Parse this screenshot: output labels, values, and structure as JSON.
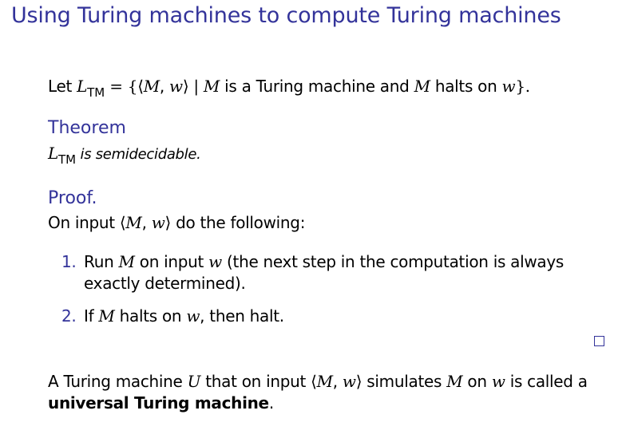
{
  "slide": {
    "title": "Using Turing machines to compute Turing machines"
  },
  "definition": {
    "prefix": "Let ",
    "set_name": "L",
    "subscript": "TM",
    "equals_part": " = {⟨",
    "m1": "M",
    "comma1": ", ",
    "w1": "w",
    "bar_part": "⟩ | ",
    "m2": "M",
    "is_a": " is a Turing machine and ",
    "m3": "M",
    "halts_on": " halts on ",
    "w2": "w",
    "close": "}."
  },
  "theorem": {
    "heading": "Theorem",
    "set_name": "L",
    "subscript": "TM",
    "statement": " is semidecidable."
  },
  "proof": {
    "heading": "Proof.",
    "intro_prefix": "On input ",
    "intro_open": "⟨",
    "intro_m": "M",
    "intro_comma": ", ",
    "intro_w": "w",
    "intro_close": "⟩",
    "intro_suffix": " do the following:",
    "steps": [
      {
        "number": "1.",
        "part1": "Run ",
        "m": "M",
        "part2": " on input ",
        "w": "w",
        "part3": " (the next step in the computation is always",
        "continuation": "exactly determined)."
      },
      {
        "number": "2.",
        "part1": "If ",
        "m": "M",
        "part2": " halts on ",
        "w": "w",
        "part3": ", then halt."
      }
    ]
  },
  "conclusion": {
    "part1": "A Turing machine ",
    "u": "U",
    "part2": " that on input ",
    "open": "⟨",
    "m1": "M",
    "comma": ", ",
    "w1": "w",
    "close": "⟩",
    "part3": " simulates ",
    "m2": "M",
    "part4": " on ",
    "w2": "w",
    "part5": " is called a",
    "bold_term": "universal Turing machine",
    "end": "."
  },
  "colors": {
    "title": "#33339a",
    "block_title": "#33339a",
    "text": "#000000"
  }
}
